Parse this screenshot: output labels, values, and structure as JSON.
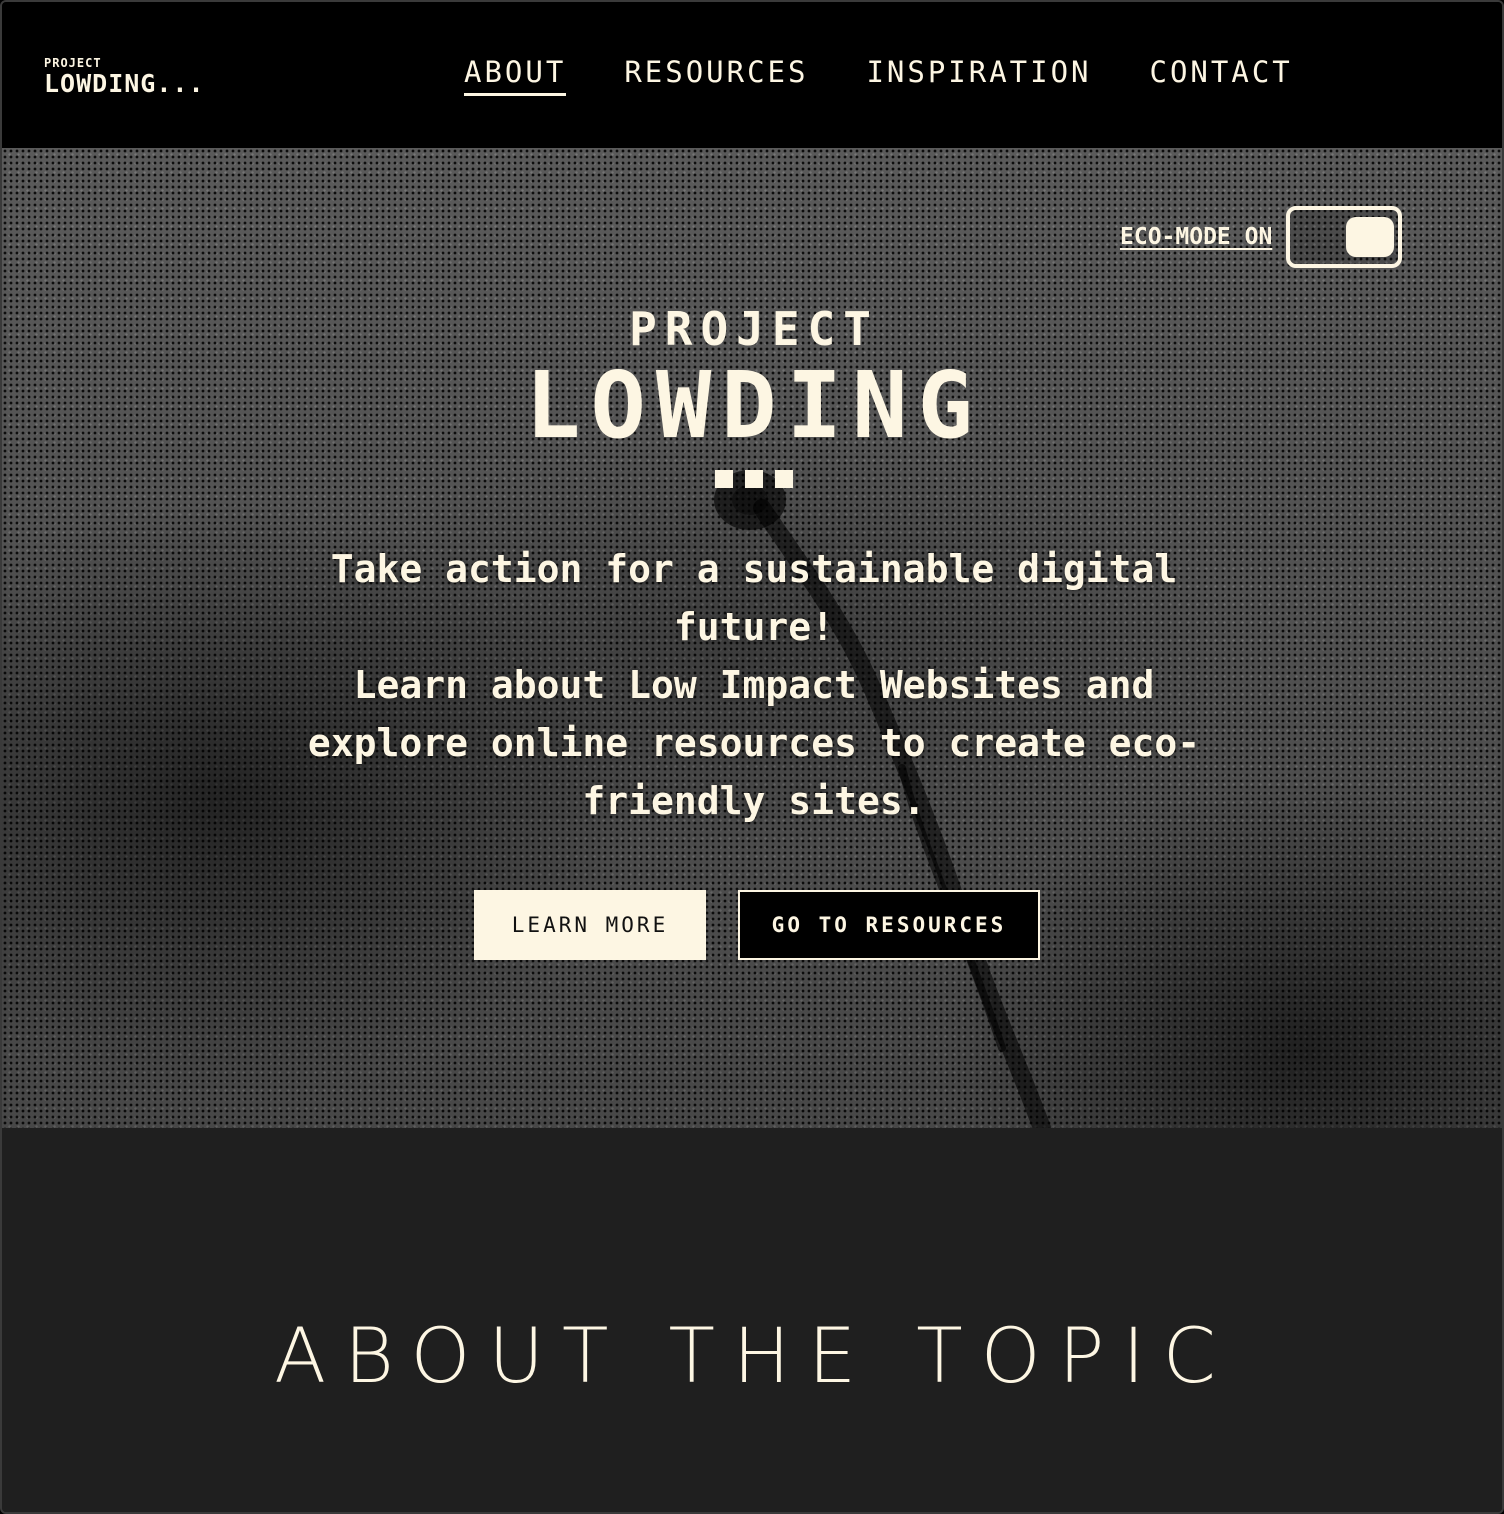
{
  "header": {
    "logo_top": "PROJECT",
    "logo_main": "LOWDING...",
    "nav": [
      {
        "label": "ABOUT",
        "active": true
      },
      {
        "label": "RESOURCES",
        "active": false
      },
      {
        "label": "INSPIRATION",
        "active": false
      },
      {
        "label": "CONTACT",
        "active": false
      }
    ]
  },
  "hero": {
    "eco_mode_label": "ECO-MODE ON",
    "eco_mode_on": true,
    "title_top": "PROJECT",
    "title_main": "LOWDING",
    "tagline_line1": "Take action for a sustainable digital future!",
    "tagline_line2": "Learn about Low Impact Websites and explore online resources to create eco-friendly sites.",
    "learn_more_label": "LEARN MORE",
    "go_to_resources_label": "GO TO RESOURCES"
  },
  "about": {
    "title": "ABOUT THE TOPIC"
  },
  "colors": {
    "cream": "#fdf6e3",
    "black": "#000000",
    "section_bg": "#1f1f1f"
  }
}
